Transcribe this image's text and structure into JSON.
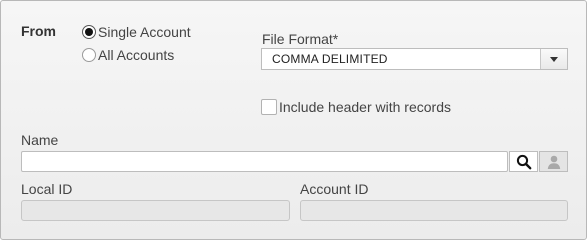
{
  "from": {
    "label": "From",
    "options": [
      {
        "label": "Single Account",
        "selected": true
      },
      {
        "label": "All Accounts",
        "selected": false
      }
    ]
  },
  "file_format": {
    "label": "File Format*",
    "selected_value": "COMMA DELIMITED"
  },
  "include_header": {
    "label": "Include header with records",
    "checked": false
  },
  "name": {
    "label": "Name",
    "value": "",
    "search_icon": "search-icon",
    "person_icon": "person-icon"
  },
  "local_id": {
    "label": "Local ID",
    "value": ""
  },
  "account_id": {
    "label": "Account ID",
    "value": ""
  },
  "colors": {
    "panel_background": "#efefef",
    "border": "#bdbdbd",
    "disabled_field": "#e7e7e7",
    "text": "#444444"
  }
}
